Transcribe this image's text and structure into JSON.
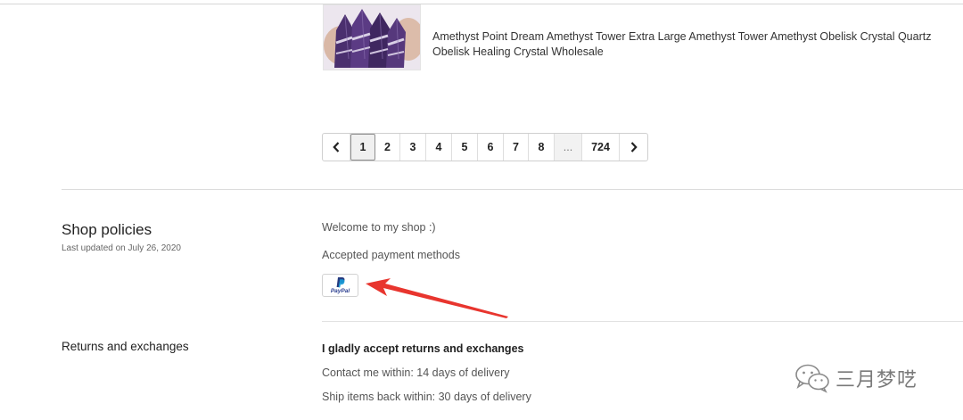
{
  "listing": {
    "title": "Amethyst Point Dream Amethyst Tower Extra Large Amethyst Tower Amethyst Obelisk Crystal Quartz Obelisk Healing Crystal Wholesale"
  },
  "pagination": {
    "pages": [
      "1",
      "2",
      "3",
      "4",
      "5",
      "6",
      "7",
      "8"
    ],
    "ellipsis": "...",
    "last_page": "724",
    "current_page": "1"
  },
  "shop_policies": {
    "title": "Shop policies",
    "last_updated": "Last updated on July 26, 2020",
    "welcome": "Welcome to my shop :)",
    "payment_heading": "Accepted payment methods",
    "payment_methods": [
      {
        "name": "PayPal",
        "label": "PayPal",
        "icon": "paypal-icon"
      }
    ]
  },
  "returns": {
    "title": "Returns and exchanges",
    "heading": "I gladly accept returns and exchanges",
    "contact": "Contact me within: 14 days of delivery",
    "ship_back": "Ship items back within: 30 days of delivery"
  },
  "watermark": {
    "text": "三月梦呓",
    "icon": "wechat-icon"
  },
  "colors": {
    "annotation_arrow": "#e8352e",
    "paypal_dark": "#253b80",
    "paypal_light": "#179bd7"
  }
}
